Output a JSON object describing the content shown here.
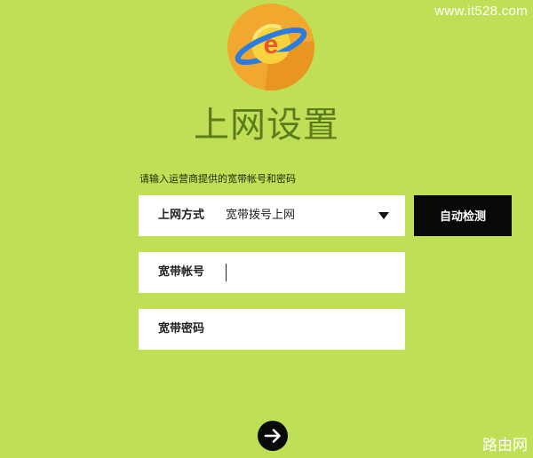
{
  "watermark_top": "www.it528.com",
  "watermark_bottom": "路由网",
  "logo": {
    "icon": "planet-e-logo-icon",
    "letter": "e"
  },
  "page_title": "上网设置",
  "hint_text": "请输入运营商提供的宽带帐号和密码",
  "connection_type": {
    "label": "上网方式",
    "selected_value": "宽带拨号上网"
  },
  "detect_button": {
    "label": "自动检测"
  },
  "account_field": {
    "label": "宽带帐号",
    "value": ""
  },
  "password_field": {
    "label": "宽带密码",
    "value": ""
  },
  "next_button": {
    "icon": "arrow-right-icon"
  },
  "colors": {
    "background": "#bfdf57",
    "title": "#5e7b1c",
    "button": "#080808",
    "logo_circle": "#f2a82f",
    "logo_ring": "#2a7ce0"
  }
}
